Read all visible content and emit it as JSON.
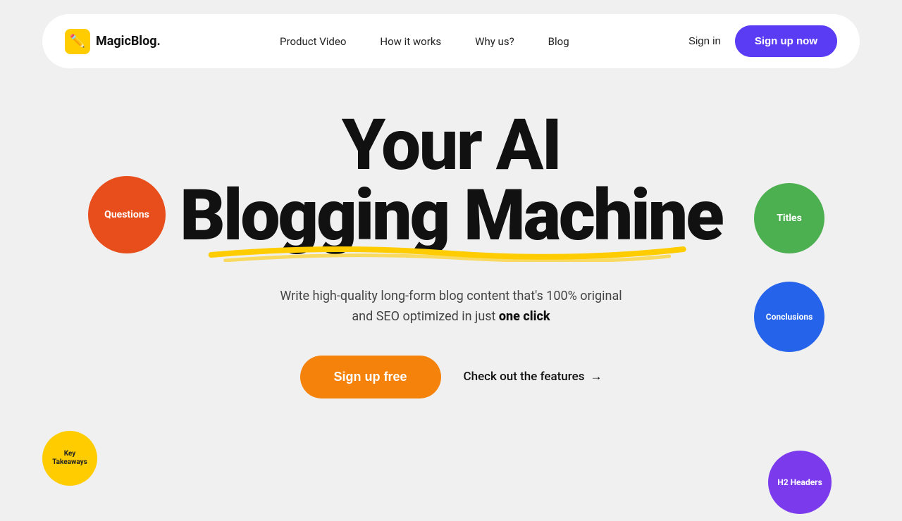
{
  "navbar": {
    "logo_text": "MagicBlog.",
    "logo_icon": "✏️",
    "nav_links": [
      {
        "label": "Product Video",
        "id": "product-video"
      },
      {
        "label": "How it works",
        "id": "how-it-works"
      },
      {
        "label": "Why us?",
        "id": "why-us"
      },
      {
        "label": "Blog",
        "id": "blog"
      }
    ],
    "sign_in_label": "Sign in",
    "sign_up_label": "Sign up now"
  },
  "hero": {
    "title_line1": "Your AI",
    "title_line2": "Blogging Machine",
    "subtitle_part1": "Write high-quality long-form blog content that's 100% original",
    "subtitle_part2": "and SEO optimized in just ",
    "subtitle_bold": "one click",
    "signup_free_label": "Sign up free",
    "check_features_label": "Check out the features",
    "arrow": "→"
  },
  "bubbles": {
    "questions": "Questions",
    "titles": "Titles",
    "conclusions": "Conclusions",
    "key_takeaways": "Key Takeaways",
    "h2_headers": "H2 Headers"
  },
  "colors": {
    "accent_purple": "#5B3CF5",
    "accent_orange": "#F5820A",
    "bubble_red": "#E84E1B",
    "bubble_green": "#4CAF50",
    "bubble_blue": "#2563EB",
    "bubble_yellow": "#FFCC00",
    "bubble_purple": "#7C3AED"
  }
}
